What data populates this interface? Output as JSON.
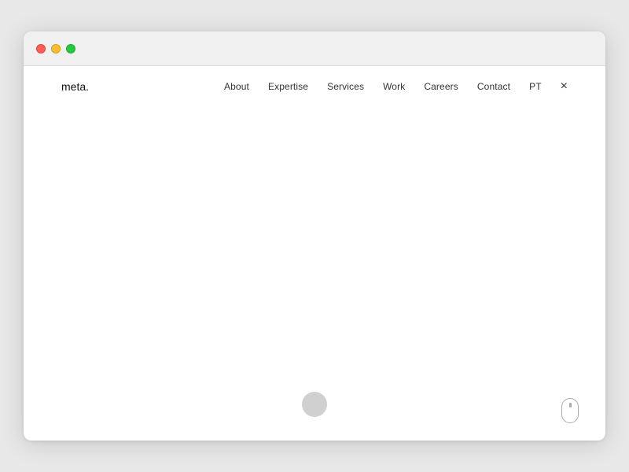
{
  "browser": {
    "traffic_lights": {
      "close_label": "close",
      "minimize_label": "minimize",
      "maximize_label": "maximize"
    }
  },
  "nav": {
    "logo": "meta.",
    "links": [
      {
        "label": "About",
        "key": "about"
      },
      {
        "label": "Expertise",
        "key": "expertise"
      },
      {
        "label": "Services",
        "key": "services"
      },
      {
        "label": "Work",
        "key": "work"
      },
      {
        "label": "Careers",
        "key": "careers"
      },
      {
        "label": "Contact",
        "key": "contact"
      }
    ],
    "lang": "PT",
    "close_icon": "×"
  },
  "scroll_indicator": {
    "circle_label": "scroll-down"
  }
}
